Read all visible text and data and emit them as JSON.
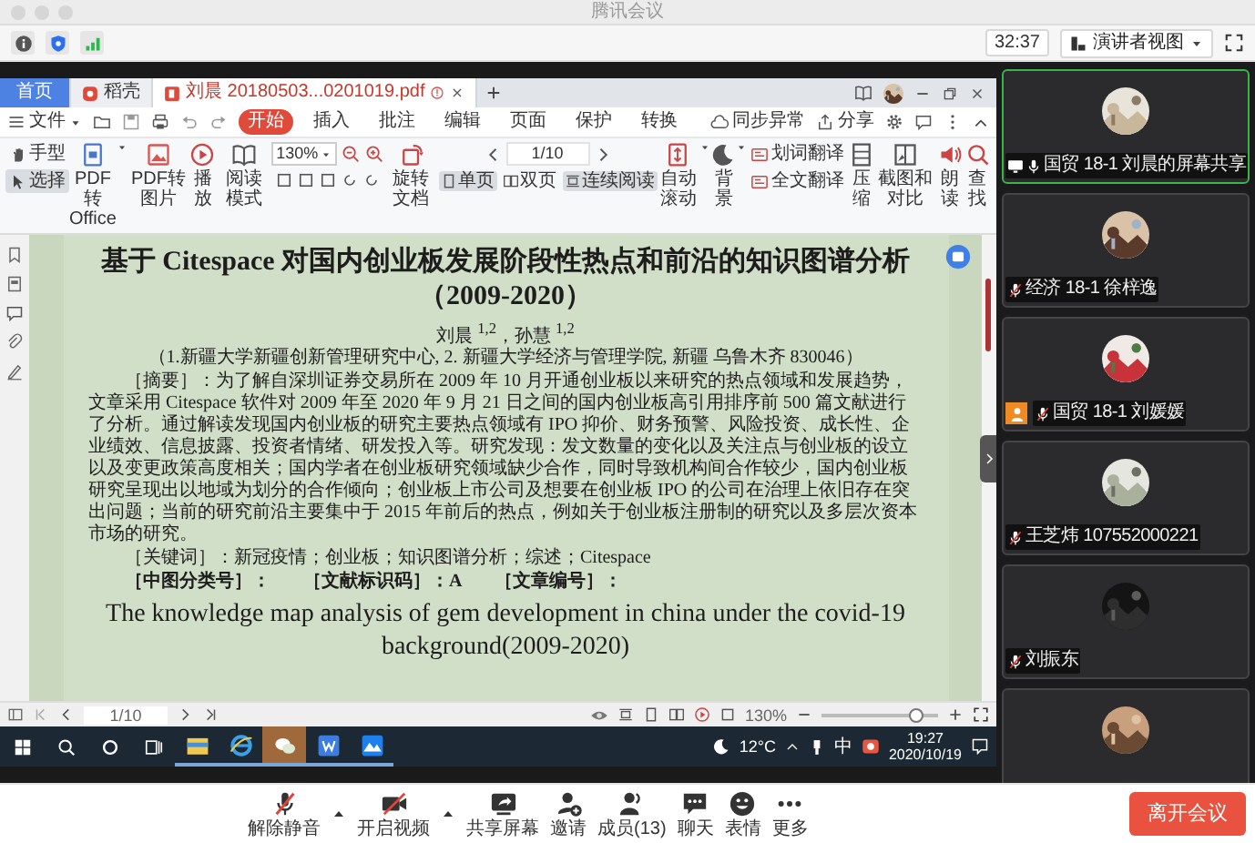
{
  "window": {
    "title": "腾讯会议"
  },
  "meeting_bar": {
    "timer": "32:37",
    "view_mode": "演讲者视图"
  },
  "shared_screen": {
    "tabs": [
      {
        "label": "首页",
        "kind": "home",
        "selected": false
      },
      {
        "label": "稻壳",
        "kind": "docer",
        "selected": false
      },
      {
        "label": "刘晨 20180503...0201019.pdf",
        "kind": "pdf",
        "selected": true
      }
    ],
    "file_menu": "文件",
    "menu": [
      {
        "label": "开始",
        "selected": true
      },
      {
        "label": "插入",
        "selected": false
      },
      {
        "label": "批注",
        "selected": false
      },
      {
        "label": "编辑",
        "selected": false
      },
      {
        "label": "页面",
        "selected": false
      },
      {
        "label": "保护",
        "selected": false
      },
      {
        "label": "转换",
        "selected": false
      }
    ],
    "sync_status": "同步异常",
    "share": "分享",
    "ribbon": [
      {
        "kind": "stack",
        "items": [
          {
            "label": "手型",
            "selected": false
          },
          {
            "label": "选择",
            "selected": true
          }
        ]
      },
      {
        "kind": "tool",
        "label": "PDF转Office",
        "dropdown": true
      },
      {
        "kind": "tool",
        "label": "PDF转图片"
      },
      {
        "kind": "tool",
        "label": "播放"
      },
      {
        "kind": "tool",
        "label": "阅读模式"
      },
      {
        "kind": "zoom",
        "value": "130%"
      },
      {
        "kind": "tool",
        "label": "旋转文档"
      },
      {
        "kind": "pager",
        "page": "1/10",
        "modes": [
          {
            "label": "单页",
            "selected": true
          },
          {
            "label": "双页",
            "selected": false
          },
          {
            "label": "连续阅读",
            "selected": true
          }
        ]
      },
      {
        "kind": "tool",
        "label": "自动滚动",
        "dropdown": true
      },
      {
        "kind": "tool",
        "label": "背景",
        "dropdown": true
      },
      {
        "kind": "stack",
        "items": [
          {
            "label": "划词翻译",
            "selected": false
          },
          {
            "label": "全文翻译",
            "selected": false
          }
        ]
      },
      {
        "kind": "tool",
        "label": "压缩"
      },
      {
        "kind": "tool",
        "label": "截图和对比"
      },
      {
        "kind": "tool",
        "label": "朗读"
      },
      {
        "kind": "tool",
        "label": "查找"
      }
    ],
    "document": {
      "title": "基于 Citespace 对国内创业板发展阶段性热点和前沿的知识图谱分析（2009-2020）",
      "authors": "刘晨 $^{1,2}$，孙慧 $^{1,2}$",
      "affiliation": "（1.新疆大学新疆创新管理研究中心, 2. 新疆大学经济与管理学院, 新疆 乌鲁木齐 830046）",
      "abstract": "［摘要］：为了解自深圳证券交易所在 2009 年 10 月开通创业板以来研究的热点领域和发展趋势，文章采用 Citespace 软件对 2009 年至 2020 年 9 月 21 日之间的国内创业板高引用排序前 500 篇文献进行了分析。通过解读发现国内创业板的研究主要热点领域有 IPO 抑价、财务预警、风险投资、成长性、企业绩效、信息披露、投资者情绪、研发投入等。研究发现：发文数量的变化以及关注点与创业板的设立以及变更政策高度相关；国内学者在创业板研究领域缺少合作，同时导致机构间合作较少，国内创业板研究呈现出以地域为划分的合作倾向；创业板上市公司及想要在创业板 IPO 的公司在治理上依旧存在突出问题；当前的研究前沿主要集中于 2015 年前后的热点，例如关于创业板注册制的研究以及多层次资本市场的研究。",
      "keywords": "［关键词］：新冠疫情；创业板；知识图谱分析；综述；Citespace",
      "classification": [
        "［中图分类号］：",
        "［文献标识码］：A",
        "［文章编号］："
      ],
      "english_title": "The knowledge map analysis of gem development in china under the covid-19 background(2009-2020)"
    },
    "status_bar": {
      "page": "1/10",
      "zoom": "130%",
      "level": 0.82
    },
    "taskbar": {
      "apps": [
        {
          "selected": false
        },
        {
          "selected": false
        },
        {
          "selected": true
        },
        {
          "selected": false
        },
        {
          "selected": false
        }
      ],
      "weather": "12°C",
      "ime": "中",
      "time": "19:27",
      "date": "2020/10/19"
    }
  },
  "participants": [
    {
      "name": "国贸 18-1 刘晨的屏幕共享",
      "sharing": true,
      "muted": false,
      "badge": false,
      "selected": true
    },
    {
      "name": "经济 18-1 徐梓逸",
      "sharing": false,
      "muted": true,
      "badge": false,
      "selected": false
    },
    {
      "name": "国贸 18-1 刘媛媛",
      "sharing": false,
      "muted": true,
      "badge": true,
      "selected": false
    },
    {
      "name": "王芝炜 107552000221",
      "sharing": false,
      "muted": true,
      "badge": false,
      "selected": false
    },
    {
      "name": "刘振东",
      "sharing": false,
      "muted": true,
      "badge": false,
      "selected": false
    },
    {
      "selected": false
    }
  ],
  "controls": [
    {
      "label": "解除静音",
      "menu": true
    },
    {
      "label": "开启视频",
      "menu": true
    },
    {
      "label": "共享屏幕"
    },
    {
      "label": "邀请"
    },
    {
      "label": "成员(13)"
    },
    {
      "label": "聊天"
    },
    {
      "label": "表情"
    },
    {
      "label": "更多"
    }
  ],
  "leave_button": "离开会议"
}
